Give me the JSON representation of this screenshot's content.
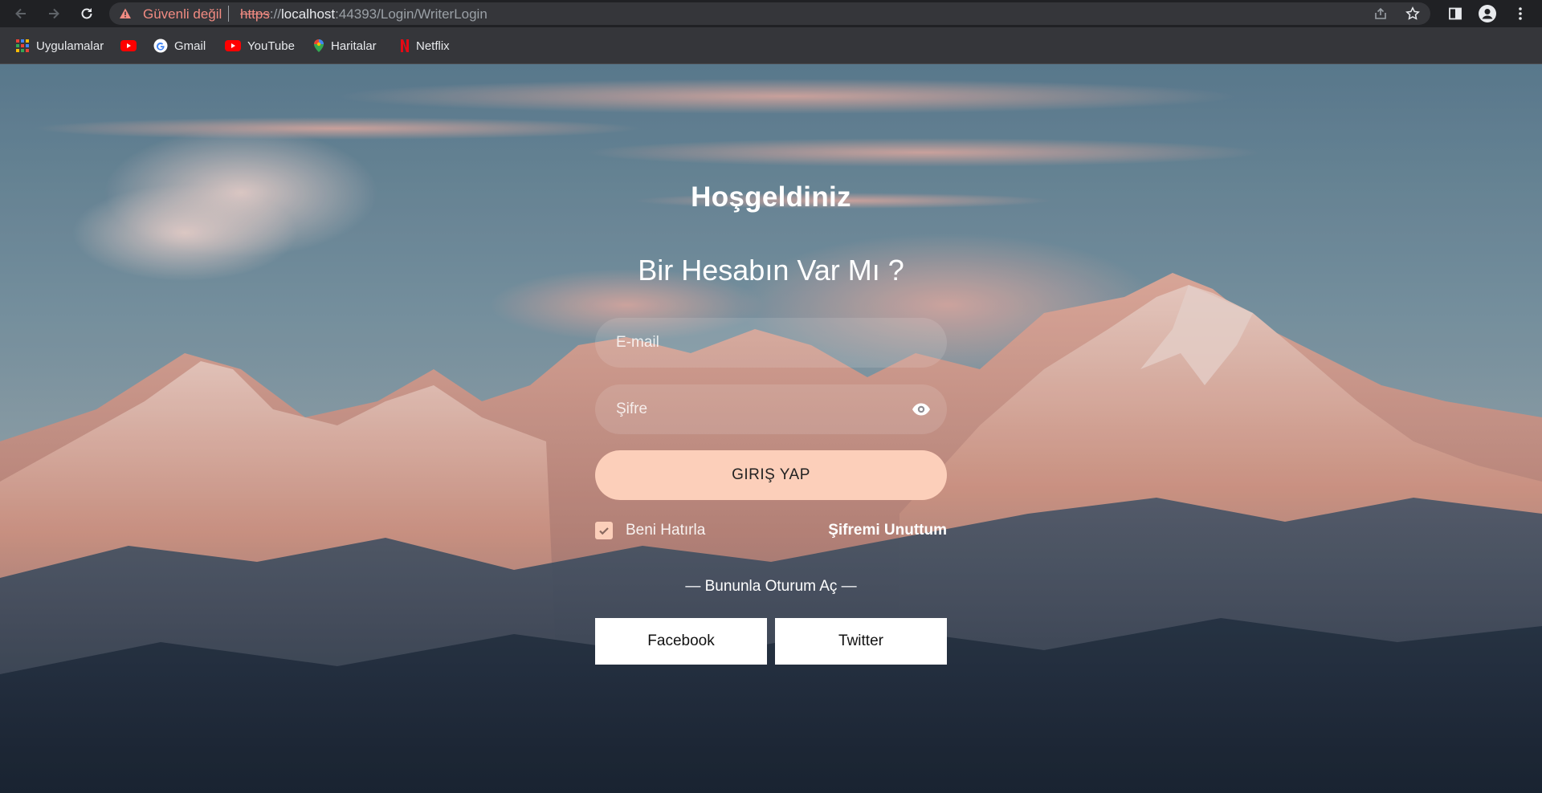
{
  "browser": {
    "security_warning": "Güvenli değil",
    "url": {
      "scheme": "https",
      "separator": "://",
      "host": "localhost",
      "rest": ":44393/Login/WriterLogin"
    },
    "icons": {
      "back": "back-arrow-icon",
      "forward": "forward-arrow-icon",
      "reload": "reload-icon",
      "warning": "warning-triangle-icon",
      "share": "share-icon",
      "bookmark": "star-icon",
      "sidepanel": "side-panel-icon",
      "profile": "profile-icon",
      "menu": "kebab-menu-icon"
    }
  },
  "bookmarks": [
    {
      "label": "Uygulamalar",
      "icon": "apps-grid-icon"
    },
    {
      "label": "",
      "icon": "youtube-icon"
    },
    {
      "label": "Gmail",
      "icon": "google-icon"
    },
    {
      "label": "YouTube",
      "icon": "youtube-icon"
    },
    {
      "label": "Haritalar",
      "icon": "maps-pin-icon"
    },
    {
      "label": "Netflix",
      "icon": "netflix-icon"
    }
  ],
  "login": {
    "welcome": "Hoşgeldiniz",
    "subtitle": "Bir Hesabın Var Mı ?",
    "email_placeholder": "E-mail",
    "password_placeholder": "Şifre",
    "login_button": "GIRIŞ YAP",
    "remember_me": "Beni Hatırla",
    "remember_checked": true,
    "forgot_password": "Şifremi Unuttum",
    "social_heading": "— Bununla Oturum Aç —",
    "facebook": "Facebook",
    "twitter": "Twitter"
  },
  "colors": {
    "accent": "#fccfba",
    "warning": "#f28b82",
    "chrome_bg": "#202124",
    "toolbar_bg": "#35363a"
  }
}
